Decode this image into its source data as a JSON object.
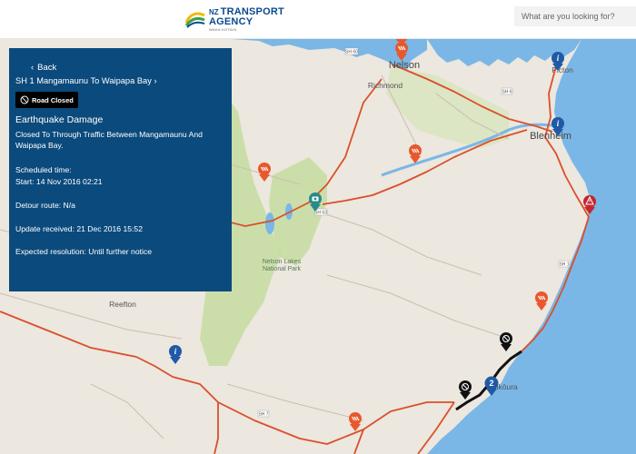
{
  "header": {
    "logo_nz": "NZ",
    "logo_line1": "TRANSPORT",
    "logo_line2": "AGENCY",
    "logo_sub": "WAKA KOTAHI",
    "search_placeholder": "What are you looking for?"
  },
  "panel": {
    "back_label": "Back",
    "route": "SH 1 Mangamaunu To Waipapa Bay",
    "badge": "Road Closed",
    "title": "Earthquake Damage",
    "description": "Closed To Through Traffic Between Mangamaunu And Waipapa Bay.",
    "scheduled_label": "Scheduled time:",
    "scheduled_value": "Start: 14 Nov 2016 02:21",
    "detour": "Detour route: N/a",
    "update": "Update received: 21 Dec 2016 15:52",
    "resolution": "Expected resolution: Until further notice"
  },
  "map": {
    "places": {
      "nelson": "Nelson",
      "richmond": "Richmond",
      "picton": "Picton",
      "blenheim": "Blenheim",
      "reefton": "Reefton",
      "park": "Nelson Lakes National Park",
      "kaikoura": "Kaikōura"
    },
    "shields": {
      "sh60": "SH 60",
      "sh6": "SH 6",
      "sh63": "SH 63",
      "sh1": "SH 1",
      "sh7": "SH 7"
    },
    "markers": {
      "cluster_count": "2"
    },
    "colors": {
      "sea": "#7ab7e6",
      "land": "#ece7df",
      "forest": "#c6dca1",
      "state_highway": "#d9502a",
      "closed_road": "#111111",
      "roadworks": "#e8582c",
      "warning": "#c4262e",
      "info": "#1f5aa6",
      "camera": "#2a8a8a"
    }
  }
}
